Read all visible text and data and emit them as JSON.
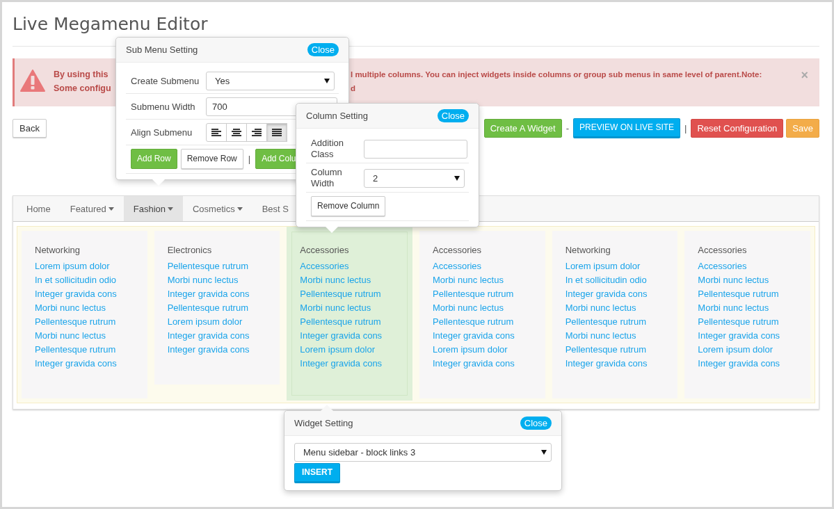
{
  "page_title": "Live Megamenu Editor",
  "alert": {
    "left_lines": [
      "By using this",
      "Some configu"
    ],
    "right_lines": [
      "l multiple columns. You can inject widgets inside columns or group sub menus in same level of parent.Note:",
      "d"
    ],
    "close": "×"
  },
  "back_button": "Back",
  "actions": [
    {
      "kind": "success",
      "label": "Create A Widget"
    },
    {
      "kind": "separator",
      "label": "-"
    },
    {
      "kind": "primary",
      "label": "PREVIEW ON LIVE SITE"
    },
    {
      "kind": "separator",
      "label": "|"
    },
    {
      "kind": "danger",
      "label": "Reset Configuration"
    },
    {
      "kind": "warning",
      "label": "Save"
    }
  ],
  "nav": [
    {
      "label": "Home",
      "dropdown": false,
      "selected": false
    },
    {
      "label": "Featured",
      "dropdown": true,
      "selected": false
    },
    {
      "label": "Fashion",
      "dropdown": true,
      "selected": true
    },
    {
      "label": "Cosmetics",
      "dropdown": true,
      "selected": false
    },
    {
      "label": "Best S",
      "dropdown": false,
      "selected": false
    }
  ],
  "columns": [
    {
      "heading": "Networking",
      "selected": false,
      "links": [
        "Lorem ipsum dolor",
        "In et sollicitudin odio",
        "Integer gravida cons",
        "Morbi nunc lectus",
        "Pellentesque rutrum",
        "Morbi nunc lectus",
        "Pellentesque rutrum",
        "Integer gravida cons"
      ]
    },
    {
      "heading": "Electronics",
      "selected": false,
      "links": [
        "Pellentesque rutrum",
        "Morbi nunc lectus",
        "Integer gravida cons",
        "Pellentesque rutrum",
        "Lorem ipsum dolor",
        "Integer gravida cons",
        "Integer gravida cons"
      ]
    },
    {
      "heading": "Accessories",
      "selected": true,
      "links": [
        "Accessories",
        "Morbi nunc lectus",
        "Pellentesque rutrum",
        "Morbi nunc lectus",
        "Pellentesque rutrum",
        "Integer gravida cons",
        "Lorem ipsum dolor",
        "Integer gravida cons"
      ]
    },
    {
      "heading": "Accessories",
      "selected": false,
      "links": [
        "Accessories",
        "Morbi nunc lectus",
        "Pellentesque rutrum",
        "Morbi nunc lectus",
        "Pellentesque rutrum",
        "Integer gravida cons",
        "Lorem ipsum dolor",
        "Integer gravida cons"
      ]
    },
    {
      "heading": "Networking",
      "selected": false,
      "links": [
        "Lorem ipsum dolor",
        "In et sollicitudin odio",
        "Integer gravida cons",
        "Morbi nunc lectus",
        "Pellentesque rutrum",
        "Morbi nunc lectus",
        "Pellentesque rutrum",
        "Integer gravida cons"
      ]
    },
    {
      "heading": "Accessories",
      "selected": false,
      "links": [
        "Accessories",
        "Morbi nunc lectus",
        "Pellentesque rutrum",
        "Morbi nunc lectus",
        "Pellentesque rutrum",
        "Integer gravida cons",
        "Lorem ipsum dolor",
        "Integer gravida cons"
      ]
    }
  ],
  "submenu_popover": {
    "title": "Sub Menu Setting",
    "close": "Close",
    "fields": [
      {
        "kind": "select",
        "label": "Create Submenu",
        "value": "Yes"
      },
      {
        "kind": "text",
        "label": "Submenu Width",
        "value": "700"
      },
      {
        "kind": "align",
        "label": "Align Submenu",
        "options": [
          {
            "selected": false
          },
          {
            "selected": false
          },
          {
            "selected": false
          },
          {
            "selected": true
          }
        ]
      }
    ],
    "buttons": [
      {
        "kind": "success",
        "label": "Add Row"
      },
      {
        "kind": "default",
        "label": "Remove Row"
      },
      {
        "kind": "separator",
        "label": "|"
      },
      {
        "kind": "success",
        "label": "Add Colu"
      }
    ]
  },
  "column_popover": {
    "title": "Column Setting",
    "close": "Close",
    "fields": [
      {
        "kind": "text",
        "label": "Addition Class"
      },
      {
        "kind": "select",
        "label": "Column Width",
        "value": "2"
      }
    ],
    "buttons": [
      {
        "kind": "default",
        "label": "Remove Column"
      }
    ]
  },
  "widget_popover": {
    "title": "Widget Setting",
    "close": "Close",
    "select_value": "Menu sidebar - block links 3",
    "button": "INSERT"
  }
}
